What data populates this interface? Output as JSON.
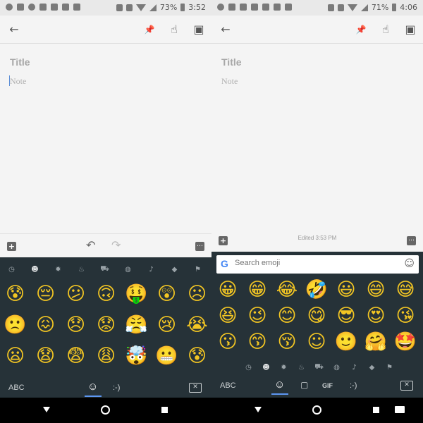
{
  "left": {
    "status": {
      "battery": "73%",
      "time": "3:52"
    },
    "note": {
      "title_placeholder": "Title",
      "note_placeholder": "Note"
    },
    "keyboard": {
      "categories": [
        "clock-icon",
        "smiley-icon",
        "gear-icon",
        "cake-icon",
        "car-icon",
        "globe-icon",
        "bell-icon",
        "diamond-icon",
        "flag-icon"
      ],
      "emojis": [
        "😰",
        "😔",
        "😕",
        "🙃",
        "🤑",
        "😲",
        "☹",
        "🙁",
        "😖",
        "😞",
        "😟",
        "😤",
        "😢",
        "😭",
        "😦",
        "😧",
        "😨",
        "😩",
        "🤯",
        "😬",
        "😰"
      ],
      "abc_label": "ABC",
      "emoticon_label": ":-)"
    }
  },
  "right": {
    "status": {
      "battery": "71%",
      "time": "4:06"
    },
    "note": {
      "title_placeholder": "Title",
      "note_placeholder": "Note",
      "edited": "Edited 3:53 PM"
    },
    "keyboard": {
      "search_placeholder": "Search emoji",
      "google_letter": "G",
      "categories": [
        "clock-icon",
        "smiley-icon",
        "gear-icon",
        "cake-icon",
        "car-icon",
        "globe-icon",
        "bell-icon",
        "diamond-icon",
        "flag-icon"
      ],
      "emojis": [
        "😀",
        "😁",
        "😂",
        "🤣",
        "😃",
        "😄",
        "😅",
        "😆",
        "😉",
        "😊",
        "😋",
        "😎",
        "😍",
        "😘",
        "😗",
        "😙",
        "😚",
        "☺",
        "🙂",
        "🤗",
        "🤩"
      ],
      "abc_label": "ABC",
      "gif_label": "GIF",
      "emoticon_label": ":-)"
    }
  },
  "icons": {
    "back": "←",
    "pin": "📌",
    "touch": "☝",
    "archive": "▣",
    "undo": "↶",
    "redo": "↷",
    "cat_glyphs": [
      "◷",
      "☻",
      "✹",
      "♨",
      "⛟",
      "◍",
      "♪",
      "◆",
      "⚑"
    ],
    "smiley": "☺",
    "sticker": "▢",
    "backspace": "✕",
    "plus": "+",
    "more": "…"
  }
}
